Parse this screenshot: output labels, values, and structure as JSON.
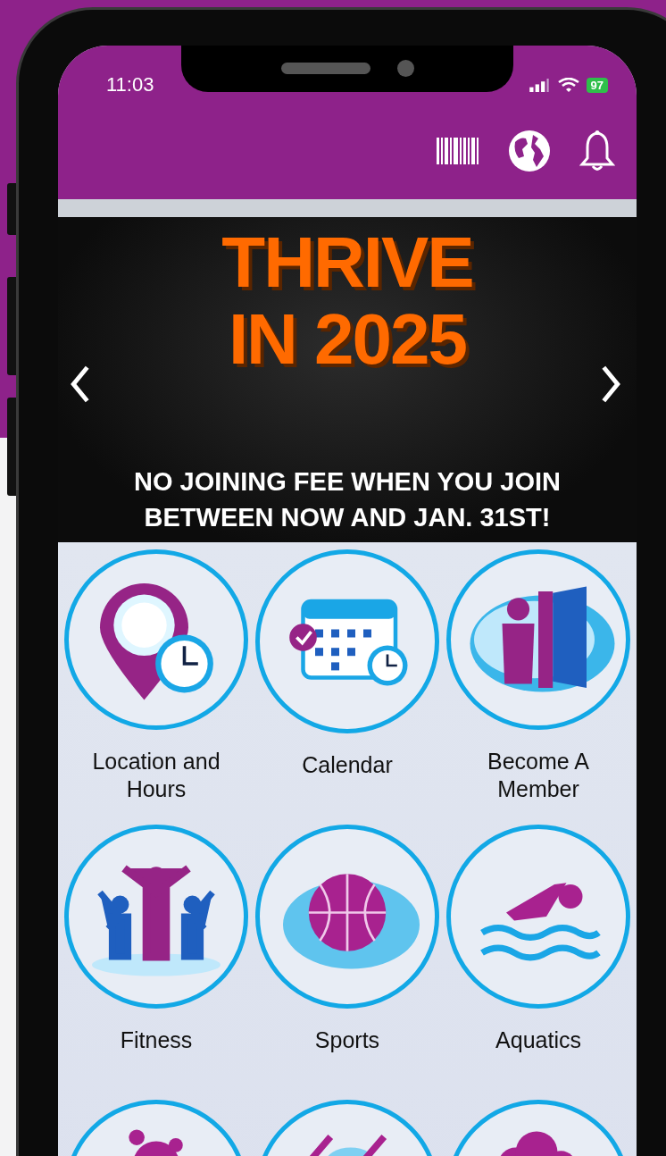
{
  "status_bar": {
    "time": "11:03",
    "battery": "97"
  },
  "banner": {
    "title_lines": [
      "THRIVE",
      "IN 2025"
    ],
    "subtitle_lines": [
      "NO JOINING FEE WHEN YOU JOIN",
      "BETWEEN NOW AND JAN. 31ST!"
    ]
  },
  "tiles": [
    {
      "kind": "location",
      "label": "Location and Hours"
    },
    {
      "kind": "calendar",
      "label": "Calendar"
    },
    {
      "kind": "member",
      "label": "Become A Member"
    },
    {
      "kind": "fitness",
      "label": "Fitness"
    },
    {
      "kind": "sports",
      "label": "Sports"
    },
    {
      "kind": "aquatics",
      "label": "Aquatics"
    },
    {
      "kind": "kids"
    },
    {
      "kind": "racquet"
    },
    {
      "kind": "party"
    }
  ]
}
